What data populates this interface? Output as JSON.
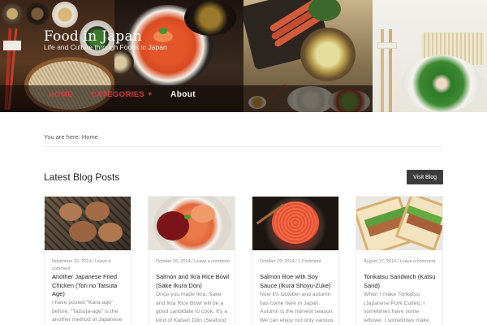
{
  "site": {
    "title": "Food in Japan",
    "tagline": "Life and Culture through Foods in Japan"
  },
  "nav": {
    "items": [
      {
        "label": "Home",
        "active": true
      },
      {
        "label": "Categories",
        "has_dropdown": true
      },
      {
        "label": "About"
      }
    ]
  },
  "breadcrumb": {
    "prefix": "You are here:",
    "current": "Home"
  },
  "section": {
    "title": "Latest Blog Posts",
    "visit_label": "Visit Blog"
  },
  "posts": [
    {
      "meta": "November 15, 2014 / Leave a comment",
      "title": "Another Japanese Fried Chicken (Tori no Tatsuta Age)",
      "excerpt": "I have posted “Kara-age” before.  “Tatsuta-age” is the another method of Japanese Fried Chicken. As same as"
    },
    {
      "meta": "October 26, 2014 / Leave a comment",
      "title": "Salmon and Ikra Rice Bowl (Sake Ikura Don)",
      "excerpt": "Once you made Ikra, Sake and Ikra Rice Bowl will be a good candidate to cook. It's a kind of Kaisen Dôn (Seafood Rice Bowl) and you"
    },
    {
      "meta": "October 19, 2014 / 1 Comment",
      "title": "Salmon Roe with Soy Sauce (Ikura Shoyu-Zuke)",
      "excerpt": "Now it's October and autumn has come here in Japan.  Autumn is the harvest season.  We can enjoy not only various"
    },
    {
      "meta": "August 17, 2014 / Leave a comment",
      "title": "Tonkatsu Sandwich (Katsu Sand)",
      "excerpt": "When I make Tonkatsu (Japanese Pork Cutlet), I sometimes have some leftover.  I sometimes make Katsu Sand like above if I"
    }
  ],
  "colors": {
    "accent_red": "#d63a3a",
    "button_dark": "#3d3d3d"
  }
}
